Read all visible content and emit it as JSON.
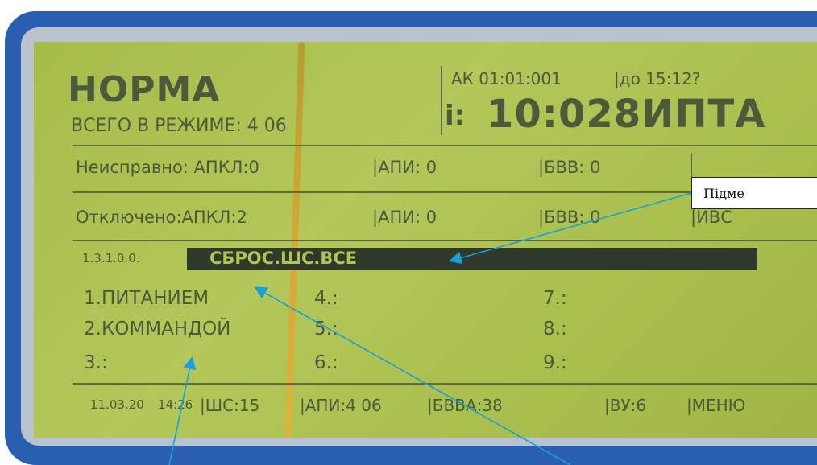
{
  "display": {
    "status_title": "НОРМА",
    "total_mode": "ВСЕГО В РЕЖИМЕ: 4 06",
    "ak_info": "АК 01:01:001",
    "do_info": "|до 15:12?",
    "time_prefix": "i:",
    "time_big": "10:028ИПТА",
    "faulty": {
      "label": "Неисправно: АПКЛ:0",
      "api": "|АПИ: 0",
      "bvv": "|БВВ: 0"
    },
    "disabled": {
      "label": "Отключено:АПКЛ:2",
      "api": "|АПИ: 0",
      "bvv": "|БВВ: 0",
      "extra": "|ИВС"
    },
    "menu_code": "1.3.1.0.0.",
    "menu_selected": "СБРОС.ШС.ВСЕ",
    "options": [
      "1.ПИТАНИЕМ",
      "4.:",
      "7.:",
      "2.КОММАНДОЙ",
      "5.:",
      "8.:",
      "3.:",
      "6.:",
      "9.:"
    ],
    "footer": {
      "date": "11.03.20",
      "time": "14:26",
      "shs": "|ШС:15",
      "api": "|АПИ:4 06",
      "bvva": "|БВВА:38",
      "vu": "|ВУ:6",
      "menu": "|МЕНЮ"
    }
  },
  "callout": {
    "text": "Підме"
  },
  "colors": {
    "bezel": "#2a5fb0",
    "lcd": "#aabf4e",
    "lcd_text": "#4d5a3a",
    "arrow": "#1aa0d8"
  }
}
